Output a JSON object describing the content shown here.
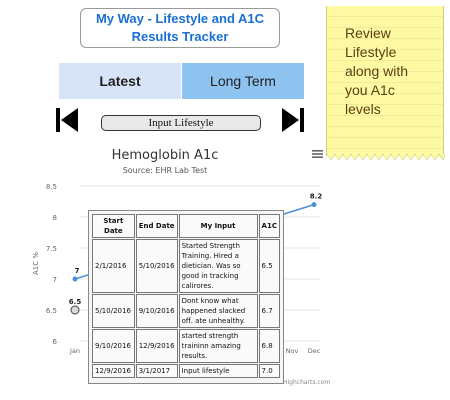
{
  "header": {
    "title_line1": "My Way - Lifestyle and A1C",
    "title_line2": "Results Tracker"
  },
  "tabs": [
    {
      "label": "Latest",
      "active": true
    },
    {
      "label": "Long Term",
      "active": false
    }
  ],
  "sticky_note": {
    "text_lines": [
      "Review",
      "Lifestyle",
      "along with",
      "you A1c",
      "levels"
    ]
  },
  "navigation": {
    "first_icon": "skip-first-icon",
    "last_icon": "skip-last-icon",
    "input_button": "Input Lifestyle"
  },
  "chart_data": {
    "type": "line",
    "title": "Hemoglobin A1c",
    "subtitle": "Source: EHR Lab Test",
    "ylabel": "A1C %",
    "ylim": [
      6,
      8.5
    ],
    "y_ticks": [
      "8.5",
      "8",
      "7.5",
      "7",
      "6.5",
      "6"
    ],
    "x_ticks_visible": [
      "Jan",
      "Nov",
      "Dec"
    ],
    "series": [
      {
        "points": [
          {
            "x": "Jan",
            "y": 7
          },
          {
            "x": "Dec",
            "y": 8.2
          }
        ],
        "point_labels": [
          "7",
          "8.2"
        ],
        "color": "#4a90d9"
      },
      {
        "points": [
          {
            "x": "Jan",
            "y": 6.5
          }
        ],
        "point_labels": [
          "6.5"
        ],
        "color": "#555555"
      }
    ],
    "credit": "Highcharts.com"
  },
  "popup_table": {
    "headers": [
      "Start Date",
      "End Date",
      "My Input",
      "A1C"
    ],
    "rows": [
      {
        "start": "2/1/2016",
        "end": "5/10/2016",
        "input": "Started Strength Training. Hired a dietician. Was so good in tracking calirores.",
        "a1c": "6.5"
      },
      {
        "start": "5/10/2016",
        "end": "9/10/2016",
        "input": "Dont know what happened slacked off. ate unhealthy.",
        "a1c": "6.7"
      },
      {
        "start": "9/10/2016",
        "end": "12/9/2016",
        "input": "started strength traininn amazing results.",
        "a1c": "6.8"
      },
      {
        "start": "12/9/2016",
        "end": "3/1/2017",
        "input": "Input lifestyle",
        "a1c": "7.0"
      }
    ]
  },
  "colors": {
    "title": "#1a6fd4",
    "tab_latest": "#d7e4f7",
    "tab_long": "#8dc3ee",
    "sticky": "#fdfaa3",
    "sticky_text": "#5a3e12"
  }
}
